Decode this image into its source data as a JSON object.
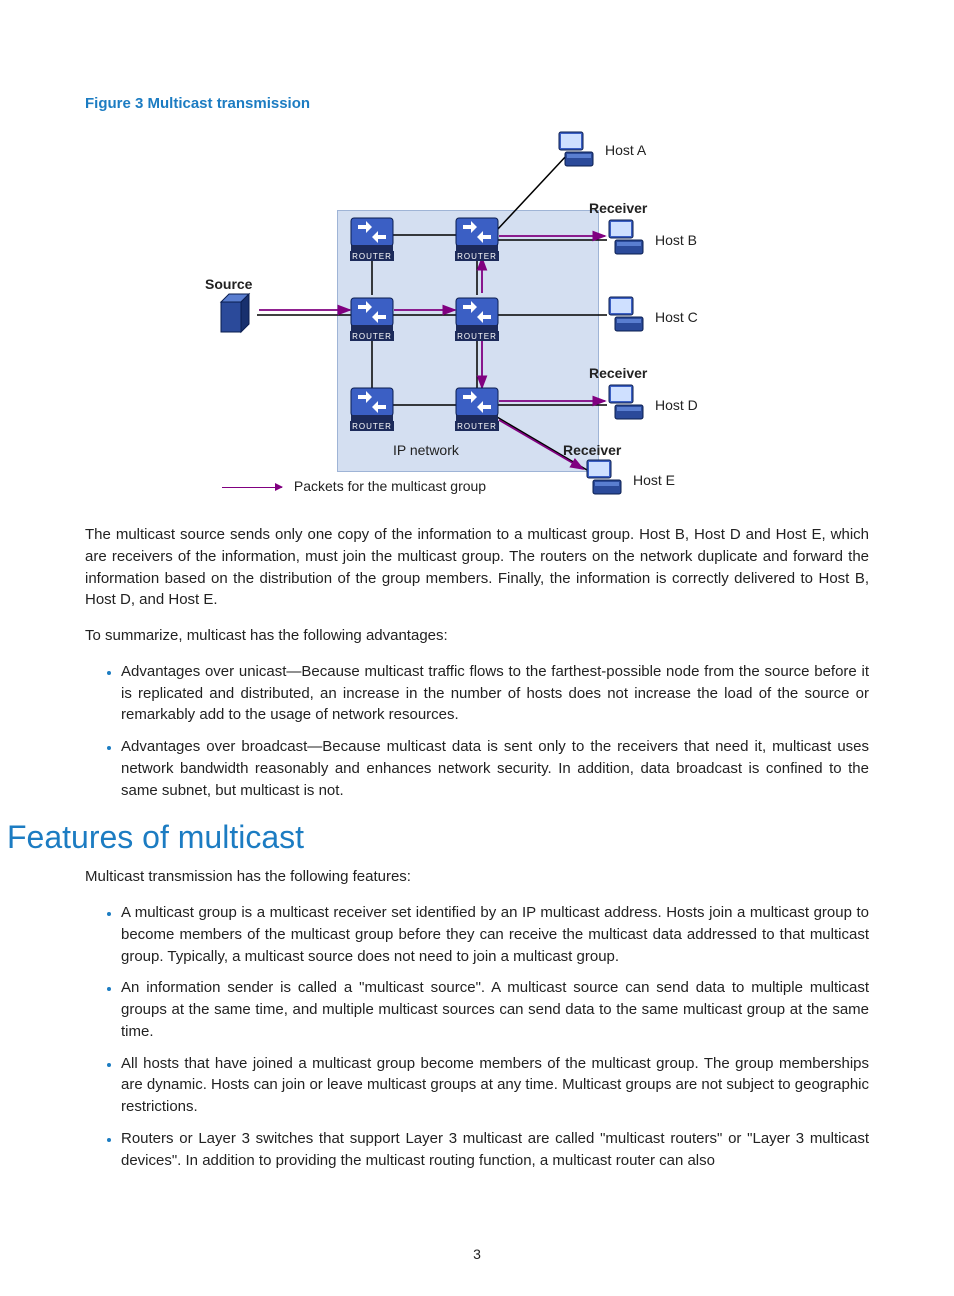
{
  "figure": {
    "caption": "Figure 3 Multicast transmission",
    "source_label": "Source",
    "receiver_label": "Receiver",
    "hosts": {
      "a": "Host A",
      "b": "Host B",
      "c": "Host C",
      "d": "Host D",
      "e": "Host E"
    },
    "ip_network_label": "IP network",
    "legend": "Packets for the multicast group",
    "router_cap": "ROUTER"
  },
  "paragraphs": {
    "p1": "The multicast source sends only one copy of the information to a multicast group. Host B, Host D and Host E, which are receivers of the information, must join the multicast group. The routers on the network duplicate and forward the information based on the distribution of the group members. Finally, the information is correctly delivered to Host B, Host D, and Host E.",
    "p2": "To summarize, multicast has the following advantages:"
  },
  "adv_bullets": [
    "Advantages over unicast—Because multicast traffic flows to the farthest-possible node from the source before it is replicated and distributed, an increase in the number of hosts does not increase the load of the source or remarkably add to the usage of network resources.",
    "Advantages over broadcast—Because multicast data is sent only to the receivers that need it, multicast uses network bandwidth reasonably and enhances network security. In addition, data broadcast is confined to the same subnet, but multicast is not."
  ],
  "section_heading": "Features of multicast",
  "features_intro": "Multicast transmission has the following features:",
  "features_bullets": [
    "A multicast group is a multicast receiver set identified by an IP multicast address. Hosts join a multicast group to become members of the multicast group before they can receive the multicast data addressed to that multicast group. Typically, a multicast source does not need to join a multicast group.",
    "An information sender is called a \"multicast source\". A multicast source can send data to multiple multicast groups at the same time, and multiple multicast sources can send data to the same multicast group at the same time.",
    "All hosts that have joined a multicast group become members of the multicast group. The group memberships are dynamic. Hosts can join or leave multicast groups at any time. Multicast groups are not subject to geographic restrictions.",
    "Routers or Layer 3 switches that support Layer 3 multicast are called \"multicast routers\" or \"Layer 3 multicast devices\". In addition to providing the multicast routing function, a multicast router can also"
  ],
  "page_number": "3"
}
